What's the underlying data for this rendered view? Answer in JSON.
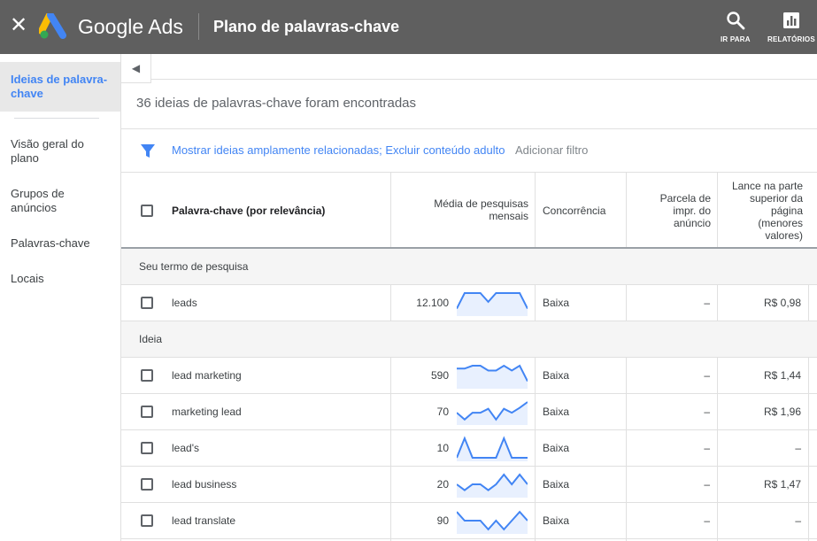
{
  "topbar": {
    "brand": "Google Ads",
    "title": "Plano de palavras-chave",
    "goto_label": "IR PARA",
    "reports_label": "RELATÓRIOS"
  },
  "sidebar": {
    "items": [
      {
        "label": "Ideias de palavra-chave",
        "active": true
      },
      {
        "label": "Visão geral do plano"
      },
      {
        "label": "Grupos de anúncios"
      },
      {
        "label": "Palavras-chave"
      },
      {
        "label": "Locais"
      }
    ]
  },
  "main": {
    "count_text": "36 ideias de palavras-chave foram encontradas",
    "filter_text": "Mostrar ideias amplamente relacionadas; Excluir conteúdo adulto",
    "add_filter": "Adicionar filtro",
    "columns": {
      "keyword": "Palavra-chave (por relevância)",
      "avg_searches": "Média de pesquisas mensais",
      "competition": "Concorrência",
      "impr_share": "Parcela de impr. do anúncio",
      "top_bid": "Lance na parte superior da página (menores valores)"
    },
    "section_search": "Seu termo de pesquisa",
    "section_ideas": "Ideia",
    "search_row": {
      "keyword": "leads",
      "searches": "12.100",
      "competition": "Baixa",
      "share": "–",
      "bid": "R$ 0,98",
      "trend": [
        0.2,
        1,
        1,
        1,
        0.55,
        1,
        1,
        1,
        1,
        0.2
      ]
    },
    "idea_rows": [
      {
        "keyword": "lead marketing",
        "searches": "590",
        "competition": "Baixa",
        "share": "–",
        "bid": "R$ 1,44",
        "trend": [
          0.85,
          0.85,
          1,
          1,
          0.75,
          0.75,
          1,
          0.75,
          1,
          0.2
        ]
      },
      {
        "keyword": "marketing lead",
        "searches": "70",
        "competition": "Baixa",
        "share": "–",
        "bid": "R$ 1,96",
        "trend": [
          0.45,
          0.1,
          0.45,
          0.45,
          0.65,
          0.1,
          0.65,
          0.45,
          0.7,
          1
        ]
      },
      {
        "keyword": "lead's",
        "searches": "10",
        "competition": "Baixa",
        "share": "–",
        "bid": "–",
        "trend": [
          0,
          1,
          0,
          0,
          0,
          0,
          1,
          0,
          0,
          0
        ]
      },
      {
        "keyword": "lead business",
        "searches": "20",
        "competition": "Baixa",
        "share": "–",
        "bid": "R$ 1,47",
        "trend": [
          0.5,
          0.2,
          0.5,
          0.5,
          0.2,
          0.5,
          1,
          0.5,
          1,
          0.5
        ]
      },
      {
        "keyword": "lead translate",
        "searches": "90",
        "competition": "Baixa",
        "share": "–",
        "bid": "–",
        "trend": [
          0.95,
          0.5,
          0.5,
          0.5,
          0.05,
          0.5,
          0.05,
          0.5,
          0.95,
          0.5
        ]
      }
    ]
  },
  "colors": {
    "accent": "#4285f4",
    "header": "#5f5f5f",
    "sparkline": "#4285f4",
    "sparkfill": "#e8f0fe"
  }
}
